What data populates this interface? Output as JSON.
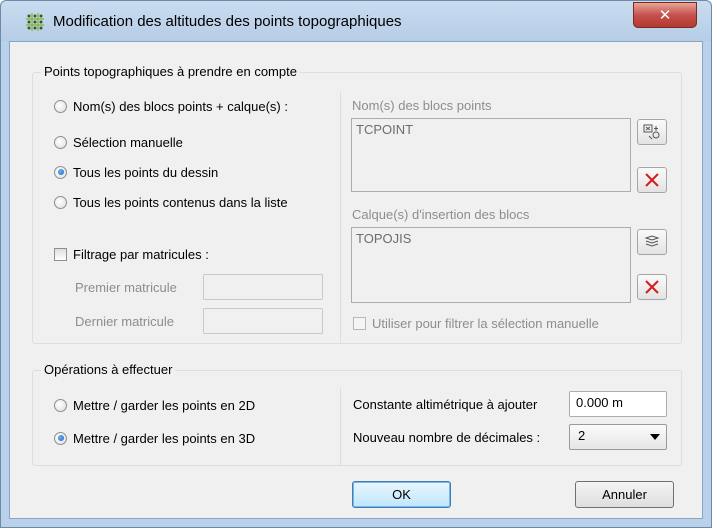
{
  "window": {
    "title": "Modification des altitudes des points topographiques",
    "close_glyph": "✕"
  },
  "points_group": {
    "legend": "Points topographiques à prendre en compte",
    "options": [
      {
        "label": "Nom(s) des blocs points + calque(s) :",
        "selected": false
      },
      {
        "label": "Sélection manuelle",
        "selected": false
      },
      {
        "label": "Tous les points du dessin",
        "selected": true
      },
      {
        "label": "Tous les points contenus dans la liste",
        "selected": false
      }
    ],
    "filter": {
      "label": "Filtrage par matricules :",
      "checked": false,
      "first_label": "Premier matricule",
      "first_value": "",
      "last_label": "Dernier matricule",
      "last_value": ""
    },
    "blocks": {
      "label": "Nom(s) des blocs points",
      "items": [
        "TCPOINT"
      ]
    },
    "layers": {
      "label": "Calque(s) d'insertion des blocs",
      "items": [
        "TOPOJIS"
      ]
    },
    "use_filter_label": "Utiliser pour filtrer la sélection manuelle",
    "use_filter_checked": false
  },
  "ops_group": {
    "legend": "Opérations à effectuer",
    "options": [
      {
        "label": "Mettre / garder les points en 2D",
        "selected": false
      },
      {
        "label": "Mettre / garder les points en 3D",
        "selected": true
      }
    ],
    "constant_label": "Constante altimétrique à ajouter",
    "constant_value": "0.000 m",
    "decimals_label": "Nouveau nombre de décimales :",
    "decimals_value": "2"
  },
  "buttons": {
    "ok": "OK",
    "cancel": "Annuler"
  },
  "colors": {
    "delete_red": "#d12020",
    "accent_blue": "#3c7fb1"
  }
}
